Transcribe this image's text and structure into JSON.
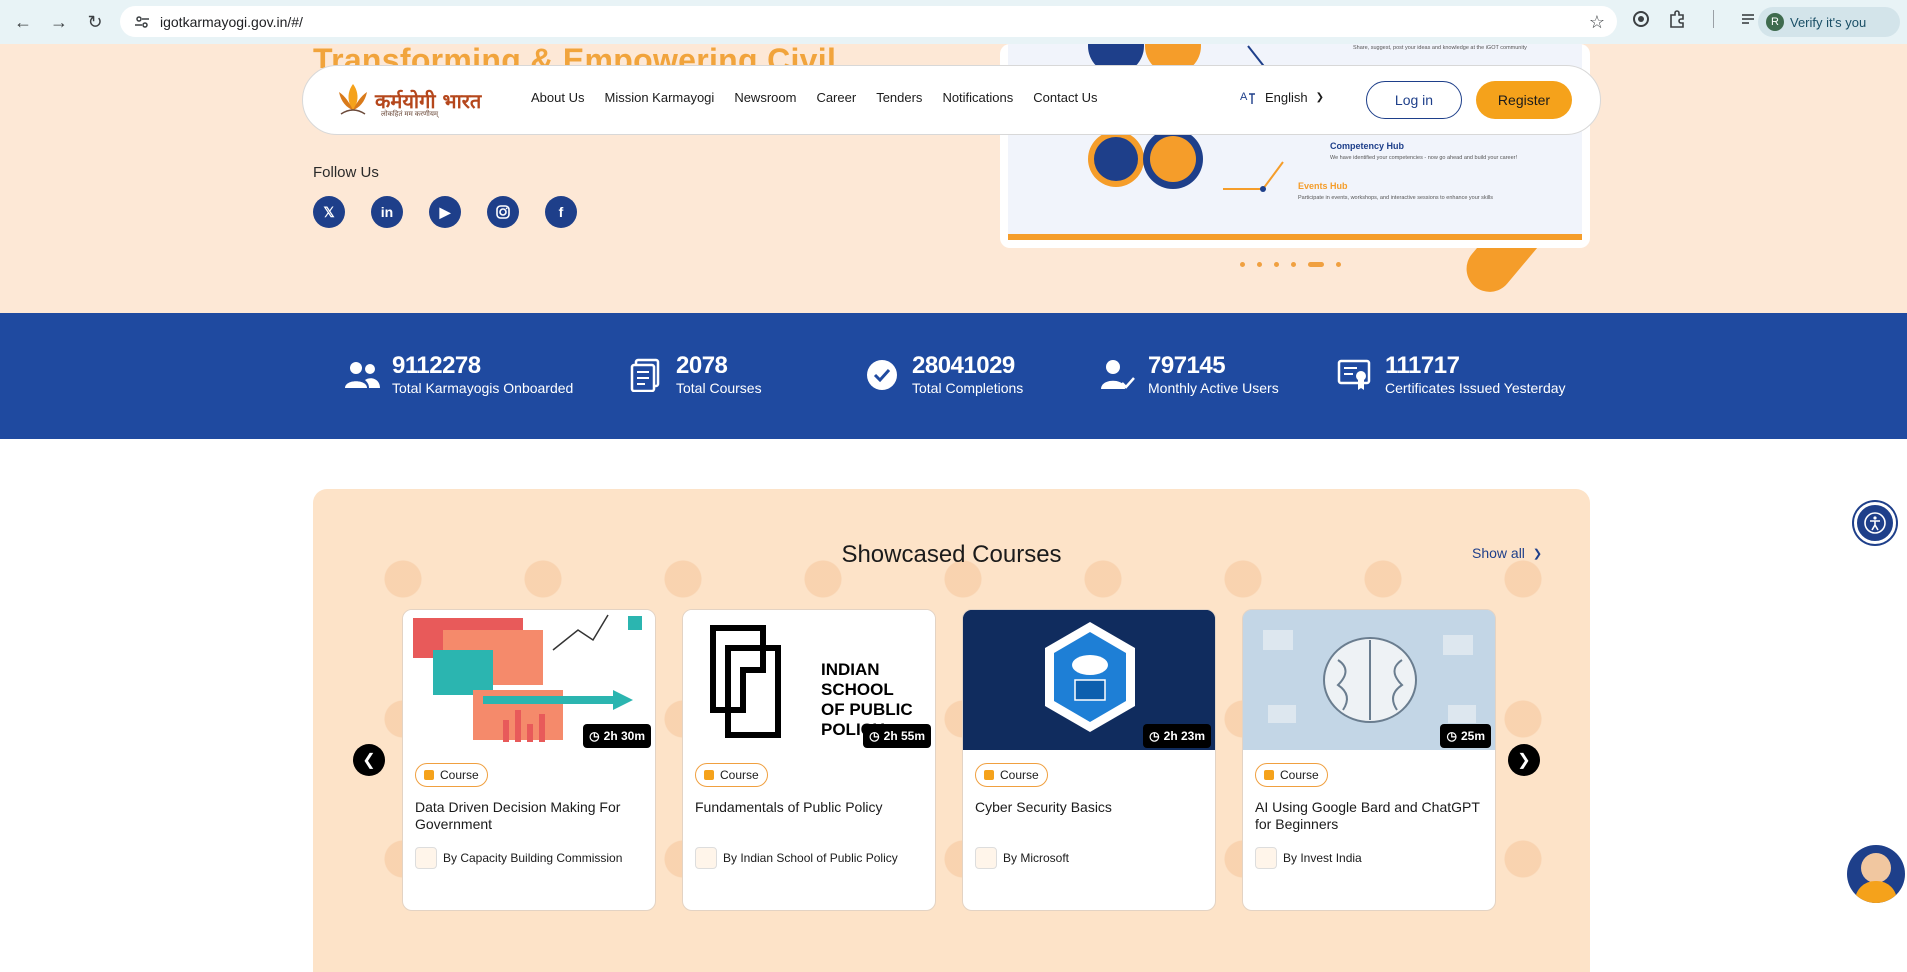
{
  "browser": {
    "url": "igotkarmayogi.gov.in/#/",
    "profile_label": "Verify it's you",
    "profile_initial": "R"
  },
  "hero": {
    "title_partial": "Transforming & Empowering Civil",
    "follow_label": "Follow Us",
    "socials": [
      "x-icon",
      "linkedin-icon",
      "youtube-icon",
      "instagram-icon",
      "facebook-icon"
    ],
    "carousel_dots": 6,
    "carousel_active_index": 4
  },
  "nav": {
    "logo_text": "कर्मयोगी भारत",
    "logo_tagline": "लोकहितं मम करणीयम्",
    "items": [
      "About Us",
      "Mission Karmayogi",
      "Newsroom",
      "Career",
      "Tenders",
      "Notifications",
      "Contact Us"
    ],
    "language": "English",
    "login": "Log in",
    "register": "Register"
  },
  "slide": {
    "hub1_title": "Competency Hub",
    "hub1_desc": "We have identified your competencies - now go ahead and build your career!",
    "hub2_title": "Events Hub",
    "hub2_desc": "Participate in events, workshops, and interactive sessions to enhance your skills",
    "top_text": "Share, suggest, post your ideas and knowledge at the iGOT community"
  },
  "stats": [
    {
      "value": "9112278",
      "label": "Total Karmayogis Onboarded",
      "icon": "users-icon"
    },
    {
      "value": "2078",
      "label": "Total Courses",
      "icon": "courses-icon"
    },
    {
      "value": "28041029",
      "label": "Total Completions",
      "icon": "check-circle-icon"
    },
    {
      "value": "797145",
      "label": "Monthly Active Users",
      "icon": "active-user-icon"
    },
    {
      "value": "111717",
      "label": "Certificates Issued Yesterday",
      "icon": "certificate-icon"
    }
  ],
  "courses": {
    "title": "Showcased Courses",
    "show_all": "Show all",
    "items": [
      {
        "duration": "2h 30m",
        "tag": "Course",
        "title": "Data Driven Decision Making For Government",
        "provider": "By Capacity Building Commission"
      },
      {
        "duration": "2h 55m",
        "tag": "Course",
        "title": "Fundamentals of Public Policy",
        "provider": "By Indian School of Public Policy",
        "thumb_text": "INDIAN SCHOOL OF PUBLIC POLICY"
      },
      {
        "duration": "2h 23m",
        "tag": "Course",
        "title": "Cyber Security Basics",
        "provider": "By Microsoft"
      },
      {
        "duration": "25m",
        "tag": "Course",
        "title": "AI Using Google Bard and ChatGPT for Beginners",
        "provider": "By Invest India"
      }
    ]
  },
  "colors": {
    "brand_blue": "#1f4aa0",
    "brand_orange": "#f5a21b",
    "hero_bg": "#fde8d6"
  }
}
